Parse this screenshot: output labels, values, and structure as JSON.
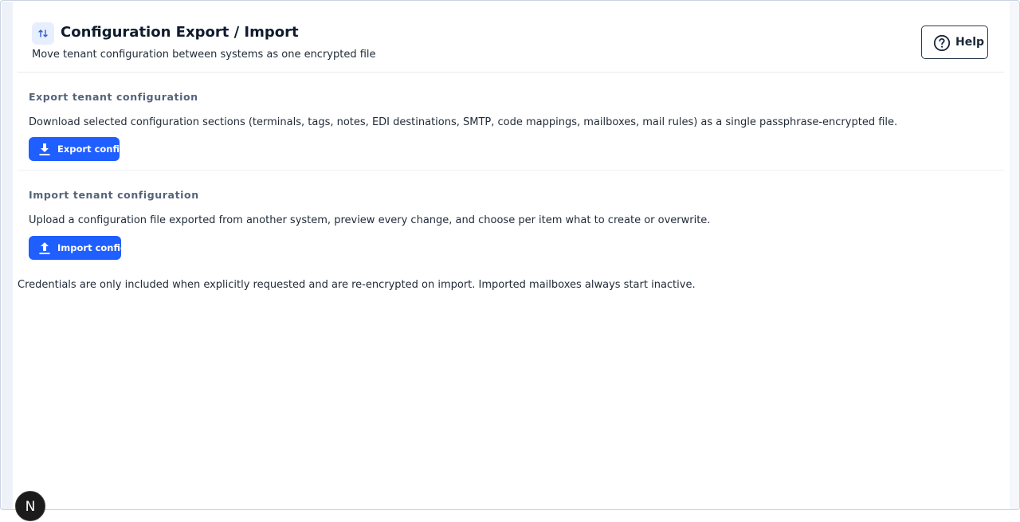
{
  "header": {
    "title": "Configuration Export / Import",
    "subtitle": "Move tenant configuration between systems as one encrypted file",
    "title_icon": "swap-vertical-icon",
    "help_label": "Help",
    "help_icon": "question-circle-icon"
  },
  "export_section": {
    "title": "Export tenant configuration",
    "description": "Download selected configuration sections (terminals, tags, notes, EDI destinations, SMTP, code mappings, mailboxes, mail rules) as a single passphrase-encrypted file.",
    "button_label": "Export config",
    "button_icon": "download-icon"
  },
  "import_section": {
    "title": "Import tenant configuration",
    "description": "Upload a configuration file exported from another system, preview every change, and choose per item what to create or overwrite.",
    "button_label": "Import config",
    "button_icon": "upload-icon"
  },
  "footnote": "Credentials are only included when explicitly requested and are re-encrypted on import. Imported mailboxes always start inactive.",
  "dev_badge": {
    "label": "N"
  },
  "colors": {
    "accent": "#1f5eff",
    "title_icon_bg": "#e7efff",
    "section_title": "#55637a"
  }
}
